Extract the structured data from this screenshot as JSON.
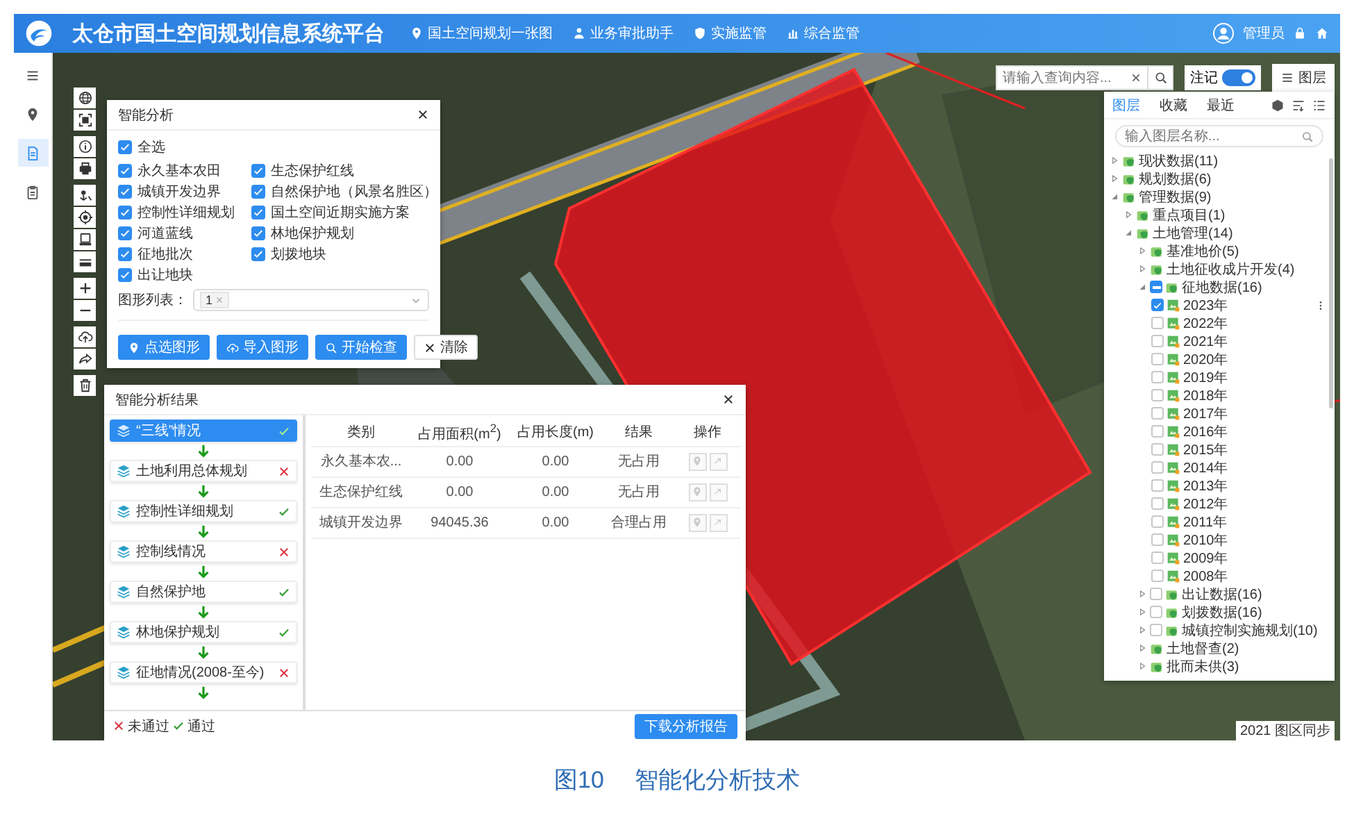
{
  "header": {
    "title": "太仓市国土空间规划信息系统平台",
    "nav": [
      {
        "label": "国土空间规划一张图"
      },
      {
        "label": "业务审批助手"
      },
      {
        "label": "实施监管"
      },
      {
        "label": "综合监管"
      }
    ],
    "user": "管理员"
  },
  "sidebar": {
    "items": [
      {
        "selected": false
      },
      {
        "selected": false
      },
      {
        "selected": true
      },
      {
        "selected": false
      }
    ]
  },
  "map_search": {
    "placeholder": "请输入查询内容..."
  },
  "label_toggle": {
    "label": "注记",
    "on": true
  },
  "layers_button": {
    "label": "图层"
  },
  "analysis_panel": {
    "title": "智能分析",
    "select_all": {
      "label": "全选",
      "checked": true
    },
    "options": [
      {
        "label": "永久基本农田",
        "checked": true
      },
      {
        "label": "生态保护红线",
        "checked": true
      },
      {
        "label": "城镇开发边界",
        "checked": true
      },
      {
        "label": "自然保护地（风景名胜区）",
        "checked": true
      },
      {
        "label": "控制性详细规划",
        "checked": true
      },
      {
        "label": "国土空间近期实施方案",
        "checked": true
      },
      {
        "label": "河道蓝线",
        "checked": true
      },
      {
        "label": "林地保护规划",
        "checked": true
      },
      {
        "label": "征地批次",
        "checked": true
      },
      {
        "label": "划拨地块",
        "checked": true
      },
      {
        "label": "出让地块",
        "checked": true
      }
    ],
    "shape_list": {
      "label": "图形列表：",
      "tags": [
        "1"
      ]
    },
    "buttons": [
      {
        "label": "点选图形",
        "kind": "primary"
      },
      {
        "label": "导入图形",
        "kind": "primary"
      },
      {
        "label": "开始检查",
        "kind": "primary"
      },
      {
        "label": "清除",
        "kind": "plain"
      }
    ]
  },
  "results_panel": {
    "title": "智能分析结果",
    "steps": [
      {
        "label": "“三线”情况",
        "passed": true,
        "selected": true
      },
      {
        "label": "土地利用总体规划",
        "passed": false,
        "selected": false
      },
      {
        "label": "控制性详细规划",
        "passed": true,
        "selected": false
      },
      {
        "label": "控制线情况",
        "passed": false,
        "selected": false
      },
      {
        "label": "自然保护地",
        "passed": true,
        "selected": false
      },
      {
        "label": "林地保护规划",
        "passed": true,
        "selected": false
      },
      {
        "label": "征地情况(2008-至今)",
        "passed": false,
        "selected": false
      }
    ],
    "table": {
      "columns": [
        "类别",
        "占用面积(m$^{2}$)",
        "占用长度(m)",
        "结果",
        "操作"
      ],
      "rows": [
        {
          "cells": [
            "永久基本农...",
            "0.00",
            "0.00",
            "无占用"
          ]
        },
        {
          "cells": [
            "生态保护红线",
            "0.00",
            "0.00",
            "无占用"
          ]
        },
        {
          "cells": [
            "城镇开发边界",
            "94045.36",
            "0.00",
            "合理占用"
          ]
        }
      ]
    },
    "legend": [
      {
        "passed": false,
        "label": "未通过"
      },
      {
        "passed": true,
        "label": "通过"
      }
    ],
    "download_button": "下载分析报告"
  },
  "layer_panel": {
    "tabs": [
      {
        "label": "图层",
        "selected": true
      },
      {
        "label": "收藏",
        "selected": false
      },
      {
        "label": "最近",
        "selected": false
      }
    ],
    "search": {
      "placeholder": "输入图层名称..."
    },
    "tree": [
      {
        "label": "现状数据(11)",
        "kind": "group",
        "expanded": false
      },
      {
        "label": "规划数据(6)",
        "kind": "group",
        "expanded": false
      },
      {
        "label": "管理数据(9)",
        "kind": "group",
        "expanded": true,
        "children": [
          {
            "label": "重点项目(1)",
            "kind": "group",
            "expanded": false
          },
          {
            "label": "土地管理(14)",
            "kind": "group",
            "expanded": true,
            "children": [
              {
                "label": "基准地价(5)",
                "kind": "group",
                "expanded": false
              },
              {
                "label": "土地征收成片开发(4)",
                "kind": "group",
                "expanded": false
              },
              {
                "label": "征地数据(16)",
                "kind": "group",
                "expanded": true,
                "indeterminate": true,
                "children": [
                  {
                    "label": "2023年",
                    "kind": "layer",
                    "checked": true,
                    "more_menu": true
                  },
                  {
                    "label": "2022年",
                    "kind": "layer",
                    "checked": false
                  },
                  {
                    "label": "2021年",
                    "kind": "layer",
                    "checked": false
                  },
                  {
                    "label": "2020年",
                    "kind": "layer",
                    "checked": false
                  },
                  {
                    "label": "2019年",
                    "kind": "layer",
                    "checked": false
                  },
                  {
                    "label": "2018年",
                    "kind": "layer",
                    "checked": false
                  },
                  {
                    "label": "2017年",
                    "kind": "layer",
                    "checked": false
                  },
                  {
                    "label": "2016年",
                    "kind": "layer",
                    "checked": false
                  },
                  {
                    "label": "2015年",
                    "kind": "layer",
                    "checked": false
                  },
                  {
                    "label": "2014年",
                    "kind": "layer",
                    "checked": false
                  },
                  {
                    "label": "2013年",
                    "kind": "layer",
                    "checked": false
                  },
                  {
                    "label": "2012年",
                    "kind": "layer",
                    "checked": false
                  },
                  {
                    "label": "2011年",
                    "kind": "layer",
                    "checked": false
                  },
                  {
                    "label": "2010年",
                    "kind": "layer",
                    "checked": false
                  },
                  {
                    "label": "2009年",
                    "kind": "layer",
                    "checked": false
                  },
                  {
                    "label": "2008年",
                    "kind": "layer",
                    "checked": false
                  }
                ]
              },
              {
                "label": "出让数据(16)",
                "kind": "group",
                "expanded": false,
                "checked": false
              },
              {
                "label": "划拨数据(16)",
                "kind": "group",
                "expanded": false,
                "checked": false
              },
              {
                "label": "城镇控制实施规划(10)",
                "kind": "group",
                "expanded": false,
                "checked": false
              },
              {
                "label": "土地督查(2)",
                "kind": "group",
                "expanded": false
              },
              {
                "label": "批而未供(3)",
                "kind": "group",
                "expanded": false
              }
            ]
          }
        ]
      }
    ]
  },
  "map_credit": "2021 图区同步",
  "caption": {
    "figure": "图10",
    "title": "智能化分析技术"
  }
}
